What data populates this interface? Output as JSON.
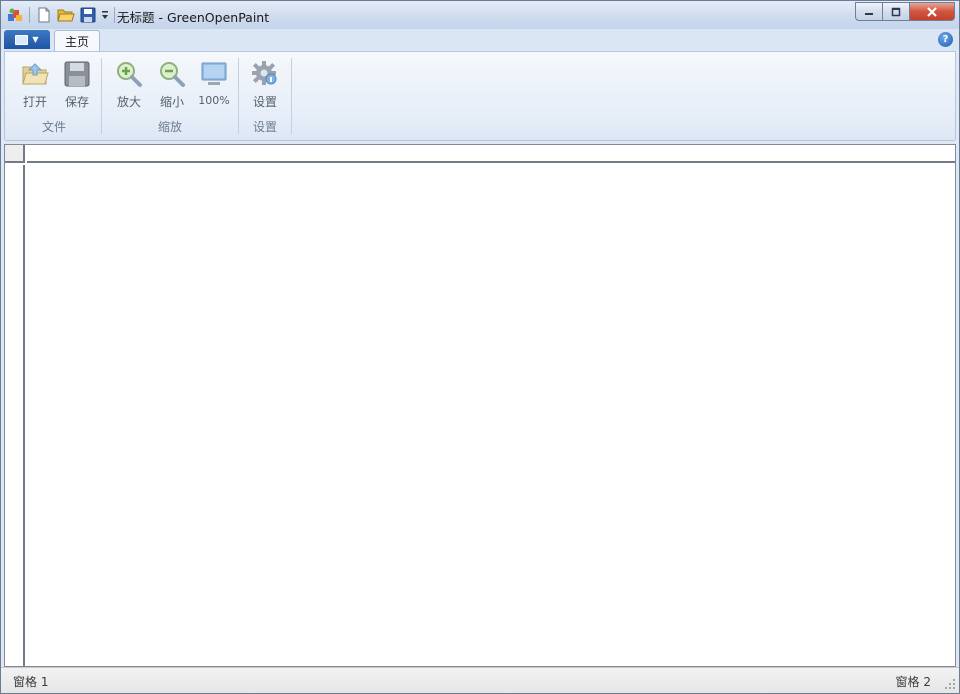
{
  "window": {
    "title": "无标题 - GreenOpenPaint"
  },
  "quick_access": {
    "items": [
      "app-icon",
      "new-file-icon",
      "open-folder-icon",
      "save-icon",
      "customize-dropdown-icon"
    ]
  },
  "ribbon": {
    "tabs": [
      {
        "label": "主页",
        "active": true
      }
    ],
    "groups": [
      {
        "label": "文件",
        "buttons": [
          {
            "label": "打开",
            "icon": "open-folder-icon"
          },
          {
            "label": "保存",
            "icon": "save-disk-icon"
          }
        ]
      },
      {
        "label": "缩放",
        "buttons": [
          {
            "label": "放大",
            "icon": "zoom-in-icon"
          },
          {
            "label": "缩小",
            "icon": "zoom-out-icon"
          },
          {
            "label": "100%",
            "icon": "monitor-icon"
          }
        ]
      },
      {
        "label": "设置",
        "buttons": [
          {
            "label": "设置",
            "icon": "gear-icon"
          }
        ]
      }
    ],
    "help_glyph": "?"
  },
  "statusbar": {
    "left": "窗格 1",
    "right": "窗格 2"
  },
  "colors": {
    "accent": "#1f55a3",
    "ribbon_bg": "#e7eef8",
    "close_button": "#c4402a"
  }
}
